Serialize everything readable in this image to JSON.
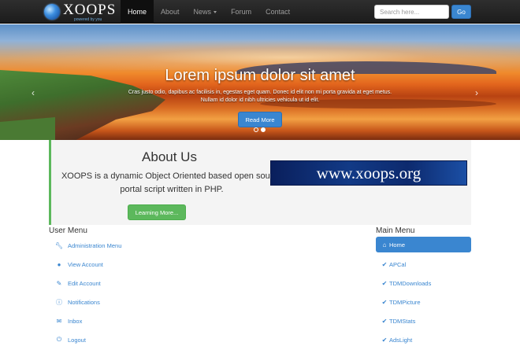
{
  "brand": {
    "name": "XOOPS",
    "tagline": "powered by you"
  },
  "nav": {
    "items": [
      {
        "label": "Home",
        "active": true
      },
      {
        "label": "About"
      },
      {
        "label": "News"
      },
      {
        "label": "Forum"
      },
      {
        "label": "Contact"
      }
    ],
    "search_placeholder": "Search here...",
    "go_label": "Go"
  },
  "hero": {
    "title": "Lorem ipsum dolor sit amet",
    "text_line1": "Cras justo odio, dapibus ac facilisis in, egestas eget quam. Donec id elit non mi porta gravida at eget metus.",
    "text_line2": "Nullam id dolor id nibh ultricies vehicula ut id elit.",
    "button_label": "Read More",
    "prev_arrow": "‹",
    "next_arrow": "›",
    "slide_count": 2,
    "active_slide": 2
  },
  "about": {
    "title": "About Us",
    "text": "XOOPS is a dynamic Object Oriented based open source portal script written in PHP.",
    "button_label": "Learning More...",
    "banner_text": "www.xoops.org"
  },
  "user_menu": {
    "title": "User Menu",
    "items": [
      {
        "label": "Administration Menu",
        "icon": "wrench-icon"
      },
      {
        "label": "View Account",
        "icon": "user-icon"
      },
      {
        "label": "Edit Account",
        "icon": "pencil-icon"
      },
      {
        "label": "Notifications",
        "icon": "info-icon"
      },
      {
        "label": "Inbox",
        "icon": "envelope-icon"
      },
      {
        "label": "Logout",
        "icon": "power-icon"
      }
    ]
  },
  "main_menu": {
    "title": "Main Menu",
    "items": [
      {
        "label": "Home",
        "icon": "home-icon",
        "active": true
      },
      {
        "label": "APCal",
        "icon": "check-icon"
      },
      {
        "label": "TDMDownloads",
        "icon": "check-icon"
      },
      {
        "label": "TDMPicture",
        "icon": "check-icon"
      },
      {
        "label": "TDMStats",
        "icon": "check-icon"
      },
      {
        "label": "AdsLight",
        "icon": "check-icon"
      }
    ]
  },
  "colors": {
    "primary": "#3a86d0",
    "success": "#5cb85c",
    "navbar": "#222222"
  }
}
